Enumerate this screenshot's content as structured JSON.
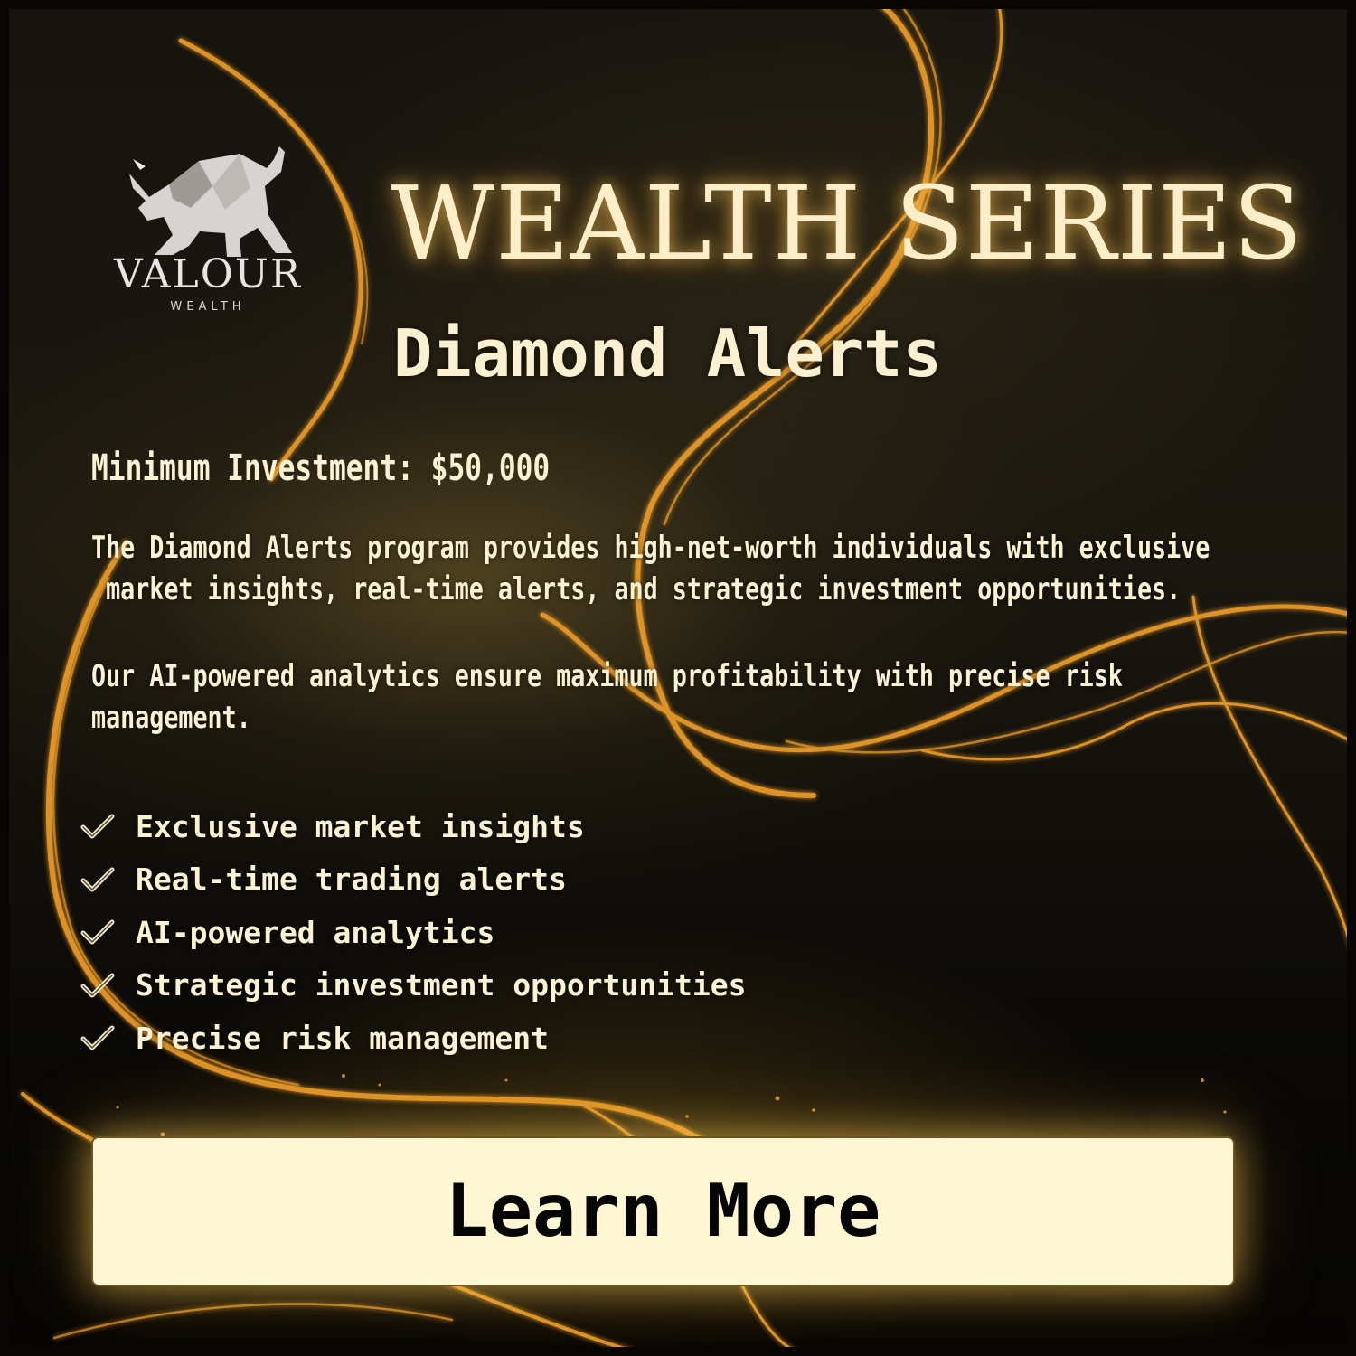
{
  "brand": {
    "name": "VALOUR",
    "tagline": "WEALTH",
    "logo_icon": "bull-icon"
  },
  "headline": "WEALTH SERIES",
  "subheadline": "Diamond Alerts",
  "minimum_investment": "Minimum Investment: $50,000",
  "paragraphs": [
    "The Diamond Alerts program provides high-net-worth individuals with exclusive\n market insights, real-time alerts, and strategic investment opportunities.",
    "Our AI-powered analytics ensure maximum profitability with precise risk\nmanagement."
  ],
  "features": [
    {
      "icon": "checkmark-icon",
      "label": "Exclusive market insights"
    },
    {
      "icon": "checkmark-icon",
      "label": "Real-time trading alerts"
    },
    {
      "icon": "checkmark-icon",
      "label": "AI-powered analytics"
    },
    {
      "icon": "checkmark-icon",
      "label": "Strategic investment opportunities"
    },
    {
      "icon": "checkmark-icon",
      "label": "Precise risk management"
    }
  ],
  "cta": {
    "label": "Learn More"
  },
  "colors": {
    "gold_text": "#fbf2d4",
    "headline_glow": "#ffc85a",
    "button_bg": "#fff6d4",
    "background": "#16140f",
    "swirl": "#e89a2a"
  }
}
